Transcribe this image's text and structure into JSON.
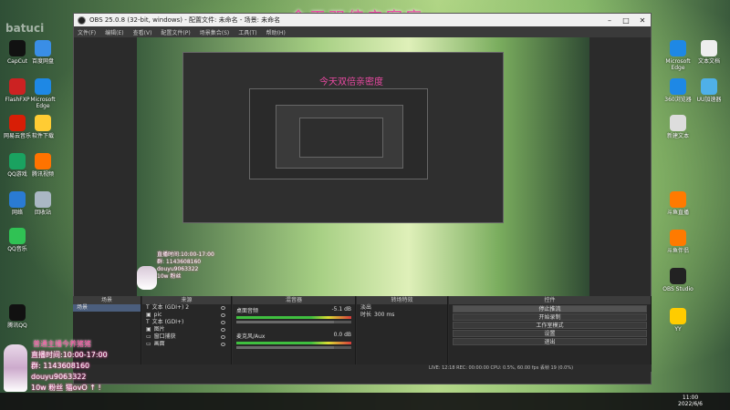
{
  "overlay_title": "今天双倍亲密度",
  "watermark": "batuci",
  "obs": {
    "window_title": "OBS 25.0.8 (32-bit, windows) - 配置文件: 未命名 - 场景: 未命名",
    "menu": [
      "文件(F)",
      "编辑(E)",
      "查看(V)",
      "配置文件(P)",
      "场景集合(S)",
      "工具(T)",
      "帮助(H)"
    ],
    "docks": {
      "scenes": {
        "title": "场景",
        "items": [
          "场景"
        ]
      },
      "sources": {
        "title": "来源",
        "items": [
          "文本 (GDI+) 2",
          "pic",
          "文本 (GDI+)",
          "图片",
          "窗口捕获",
          "画面"
        ]
      },
      "mixer": {
        "title": "混音器",
        "tracks": [
          {
            "name": "桌面音频",
            "db": "-5.1 dB"
          },
          {
            "name": "麦克风/Aux",
            "db": "0.0 dB"
          }
        ]
      },
      "transitions": {
        "title": "转场特效",
        "type": "淡出",
        "duration_label": "时长",
        "duration": "300 ms"
      },
      "controls": {
        "title": "控件",
        "buttons": [
          "停止推流",
          "开始录制",
          "工作室模式",
          "设置",
          "退出"
        ]
      }
    },
    "status": "LIVE: 12:18   REC: 00:00:00   CPU: 0.5%, 60.00 fps   丢帧 19 (0.0%)"
  },
  "streamer_overlay": {
    "lines": [
      "普通主播今养猪猪",
      "直播时间:10:00-17:00",
      "群: 1143608160",
      "douyu9063322",
      "10w 粉丝 猫ovO ↑ !"
    ]
  },
  "mini_overlay": {
    "lines": [
      "直播时间:10:00-17:00",
      "群: 1143608160",
      "douyu9063322",
      "10w 粉丝"
    ]
  },
  "taskbar": {
    "time": "11:00",
    "date": "2022/6/6"
  },
  "desktop_icons_left": [
    {
      "label": "CapCut",
      "color": "#111111"
    },
    {
      "label": "百度网盘",
      "color": "#3a8ee6"
    },
    {
      "label": "FlashFXP",
      "color": "#cc2222"
    },
    {
      "label": "Microsoft Edge",
      "color": "#1e88e5"
    },
    {
      "label": "网易云音乐",
      "color": "#d81e06"
    },
    {
      "label": "软件下载",
      "color": "#ffcc33"
    },
    {
      "label": "QQ游戏",
      "color": "#1aa260"
    },
    {
      "label": "腾讯视频",
      "color": "#ff7300"
    },
    {
      "label": "网络",
      "color": "#2a7bd3"
    },
    {
      "label": "回收站",
      "color": "#aab7c4"
    },
    {
      "label": "QQ音乐",
      "color": "#30c254"
    },
    {
      "label": "腾讯QQ",
      "color": "#111111"
    }
  ],
  "desktop_icons_right": [
    {
      "label": "Microsoft Edge",
      "color": "#1e88e5"
    },
    {
      "label": "文本文档",
      "color": "#eeeeee"
    },
    {
      "label": "360浏览器",
      "color": "#1e88e5"
    },
    {
      "label": "UU加速器",
      "color": "#4fb0e8"
    },
    {
      "label": "新建文本",
      "color": "#dddddd"
    },
    {
      "label": "斗鱼直播",
      "color": "#ff7a00"
    },
    {
      "label": "斗鱼伴侣",
      "color": "#ff7a00"
    },
    {
      "label": "OBS Studio",
      "color": "#222222"
    },
    {
      "label": "YY",
      "color": "#ffcc00"
    }
  ]
}
